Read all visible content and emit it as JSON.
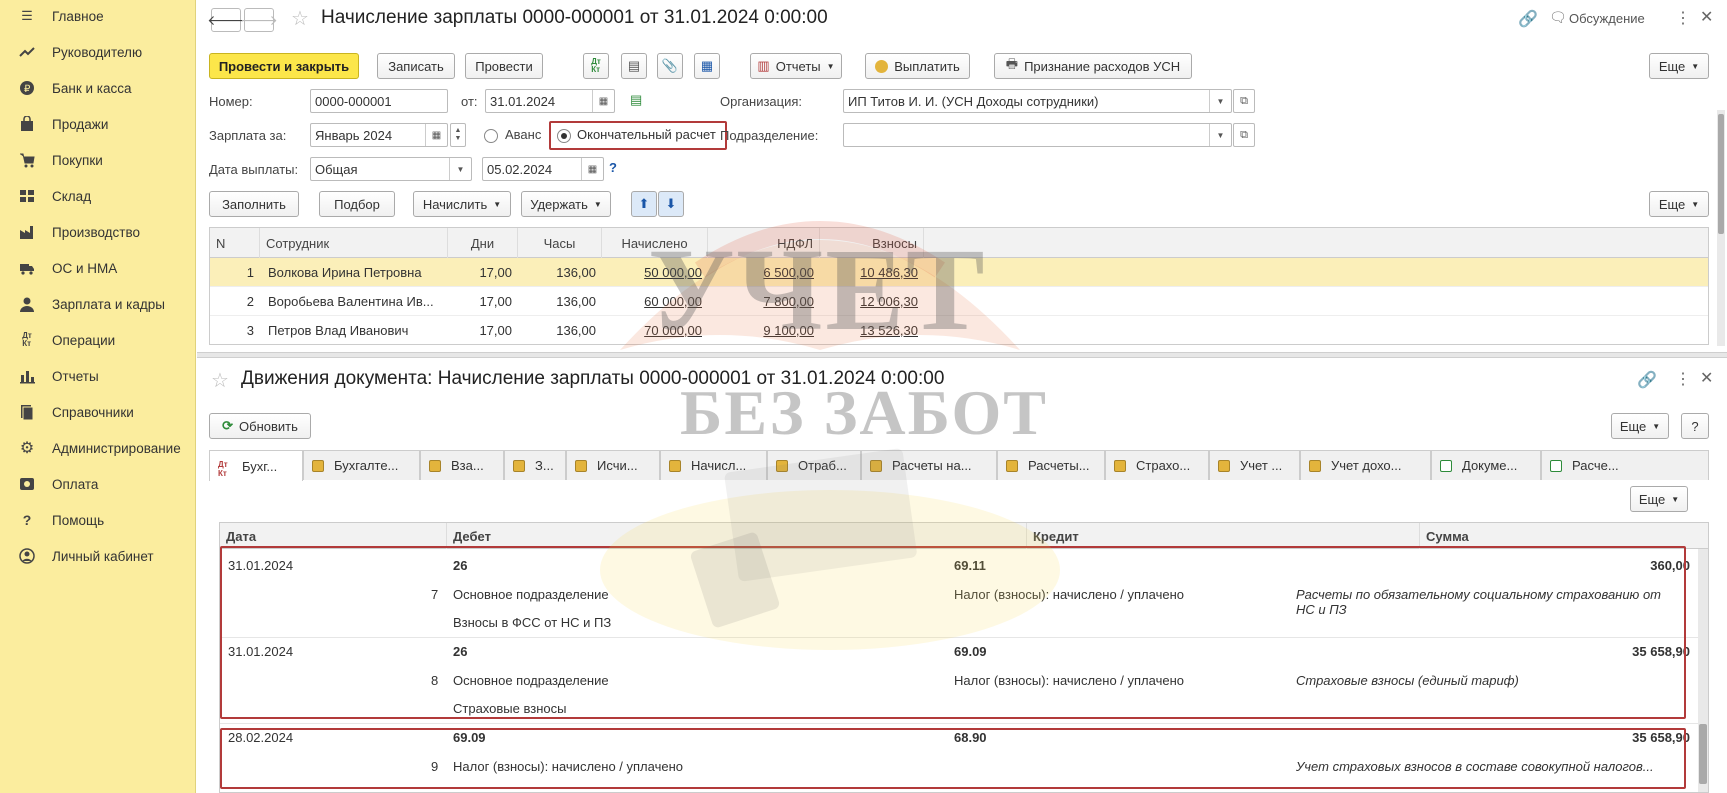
{
  "sidebar": {
    "items": [
      {
        "label": "Главное",
        "icon": "menu-icon"
      },
      {
        "label": "Руководителю",
        "icon": "trend-icon"
      },
      {
        "label": "Банк и касса",
        "icon": "bank-icon"
      },
      {
        "label": "Продажи",
        "icon": "bag-icon"
      },
      {
        "label": "Покупки",
        "icon": "cart-icon"
      },
      {
        "label": "Склад",
        "icon": "warehouse-icon"
      },
      {
        "label": "Производство",
        "icon": "factory-icon"
      },
      {
        "label": "ОС и НМА",
        "icon": "truck-icon"
      },
      {
        "label": "Зарплата и кадры",
        "icon": "person-icon"
      },
      {
        "label": "Операции",
        "icon": "dt-kt-icon"
      },
      {
        "label": "Отчеты",
        "icon": "bar-chart-icon"
      },
      {
        "label": "Справочники",
        "icon": "books-icon"
      },
      {
        "label": "Администрирование",
        "icon": "gear-icon"
      },
      {
        "label": "Оплата",
        "icon": "payment-icon"
      },
      {
        "label": "Помощь",
        "icon": "question-icon"
      },
      {
        "label": "Личный кабинет",
        "icon": "account-icon"
      }
    ]
  },
  "doc": {
    "title": "Начисление зарплаты 0000-000001 от 31.01.2024 0:00:00",
    "discussion": "Обсуждение",
    "toolbar": {
      "post_close": "Провести и закрыть",
      "save": "Записать",
      "post": "Провести",
      "reports": "Отчеты",
      "pay": "Выплатить",
      "usn": "Признание расходов УСН",
      "more": "Еще"
    },
    "form": {
      "number_label": "Номер:",
      "number": "0000-000001",
      "from_label": "от:",
      "date": "31.01.2024",
      "org_label": "Организация:",
      "org": "ИП Титов И. И. (УСН Доходы сотрудники)",
      "period_label": "Зарплата за:",
      "period": "Январь 2024",
      "advance": "Аванс",
      "final": "Окончательный расчет",
      "dept_label": "Подразделение:",
      "dept": "",
      "paydate_label": "Дата выплаты:",
      "paytype": "Общая",
      "paydate": "05.02.2024",
      "help": "?"
    },
    "grid_toolbar": {
      "fill": "Заполнить",
      "select": "Подбор",
      "accrue": "Начислить",
      "deduct": "Удержать",
      "more": "Еще"
    },
    "grid": {
      "columns": [
        "N",
        "Сотрудник",
        "Дни",
        "Часы",
        "Начислено",
        "НДФЛ",
        "Взносы"
      ],
      "rows": [
        {
          "n": "1",
          "name": "Волкова Ирина Петровна",
          "days": "17,00",
          "hours": "136,00",
          "accrued": "50 000,00",
          "ndfl": "6 500,00",
          "contrib": "10 486,30"
        },
        {
          "n": "2",
          "name": "Воробьева Валентина Ив...",
          "days": "17,00",
          "hours": "136,00",
          "accrued": "60 000,00",
          "ndfl": "7 800,00",
          "contrib": "12 006,30"
        },
        {
          "n": "3",
          "name": "Петров Влад Иванович",
          "days": "17,00",
          "hours": "136,00",
          "accrued": "70 000,00",
          "ndfl": "9 100,00",
          "contrib": "13 526,30"
        }
      ]
    }
  },
  "movements": {
    "title": "Движения документа: Начисление зарплаты 0000-000001 от 31.01.2024 0:00:00",
    "refresh": "Обновить",
    "more": "Еще",
    "help": "?",
    "tabs": [
      "Бухг...",
      "Бухгалте...",
      "Вза...",
      "З...",
      "Исчи...",
      "Начисл...",
      "Отраб...",
      "Расчеты на...",
      "Расчеты...",
      "Страхо...",
      "Учет ...",
      "Учет дохо...",
      "Докуме...",
      "Расче..."
    ],
    "inner_more": "Еще",
    "columns": [
      "Дата",
      "Дебет",
      "Кредит",
      "Сумма"
    ],
    "entries": [
      {
        "date": "31.01.2024",
        "n": "7",
        "debit": "26",
        "debit_sub1": "Основное подразделение",
        "debit_sub2": "Взносы в ФСС от НС и ПЗ",
        "credit": "69.11",
        "credit_sub": "Налог (взносы): начислено / уплачено",
        "sum": "360,00",
        "content": "Расчеты по обязательному социальному страхованию от НС и ПЗ"
      },
      {
        "date": "31.01.2024",
        "n": "8",
        "debit": "26",
        "debit_sub1": "Основное подразделение",
        "debit_sub2": "Страховые взносы",
        "credit": "69.09",
        "credit_sub": "Налог (взносы): начислено / уплачено",
        "sum": "35 658,90",
        "content": "Страховые взносы (единый тариф)"
      },
      {
        "date": "28.02.2024",
        "n": "9",
        "debit": "69.09",
        "debit_sub1": "Налог (взносы): начислено / уплачено",
        "debit_sub2": "",
        "credit": "68.90",
        "credit_sub": "",
        "sum": "35 658,90",
        "content": "Учет страховых взносов в составе совокупной налогов..."
      }
    ]
  },
  "watermark": {
    "line1": "УЧЕТ",
    "line2": "БЕЗ ЗАБОТ"
  },
  "colors": {
    "sidebar": "#fbed9e",
    "primary": "#fce64a",
    "selected_row": "#fbefb9",
    "highlight": "#b23a3a",
    "link": "#1a56a8"
  }
}
